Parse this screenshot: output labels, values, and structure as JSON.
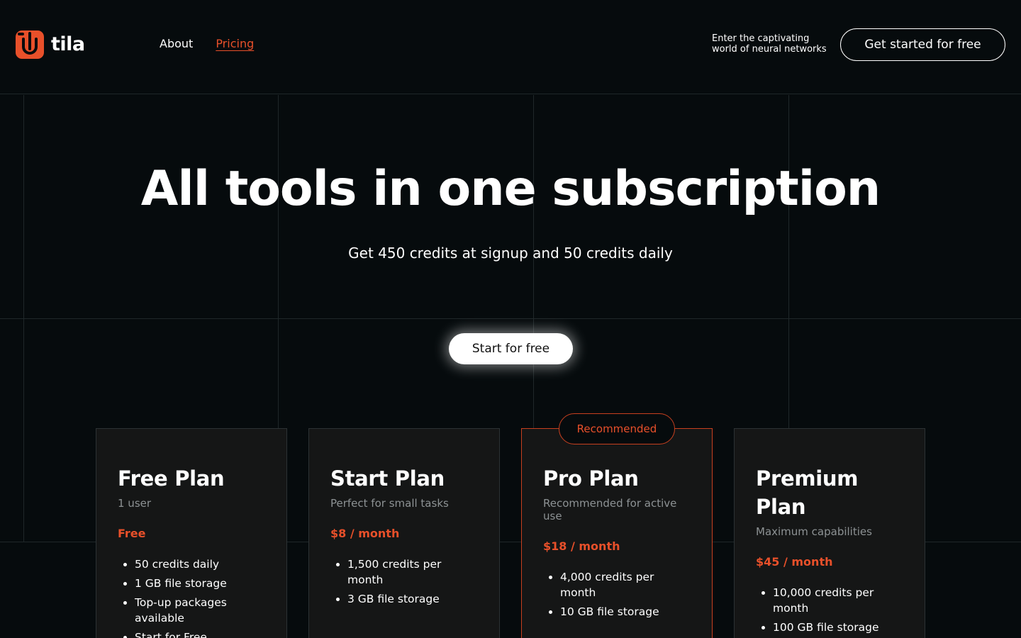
{
  "brand": {
    "name": "tila",
    "accent_color": "#e8502a"
  },
  "nav": {
    "items": [
      {
        "label": "About",
        "active": false
      },
      {
        "label": "Pricing",
        "active": true
      }
    ]
  },
  "header": {
    "tagline": "Enter the captivating world of neural networks",
    "cta_label": "Get started for free"
  },
  "hero": {
    "title": "All tools in one subscription",
    "subtitle": "Get 450 credits at signup and 50 credits daily",
    "cta_label": "Start for free"
  },
  "plans": [
    {
      "title": "Free Plan",
      "description": "1 user",
      "price": "Free",
      "features": [
        "50 credits daily",
        "1 GB file storage",
        "Top-up packages available",
        "Start for Free"
      ]
    },
    {
      "title": "Start Plan",
      "description": "Perfect for small tasks",
      "price": "$8 / month",
      "features": [
        "1,500 credits per month",
        "3 GB file storage"
      ]
    },
    {
      "title": "Pro Plan",
      "description": "Recommended for active use",
      "price": "$18 / month",
      "badge": "Recommended",
      "features": [
        "4,000 credits per month",
        "10 GB file storage"
      ]
    },
    {
      "title": "Premium Plan",
      "description": "Maximum capabilities",
      "price": "$45 / month",
      "features": [
        "10,000 credits per month",
        "100 GB file storage"
      ]
    }
  ]
}
